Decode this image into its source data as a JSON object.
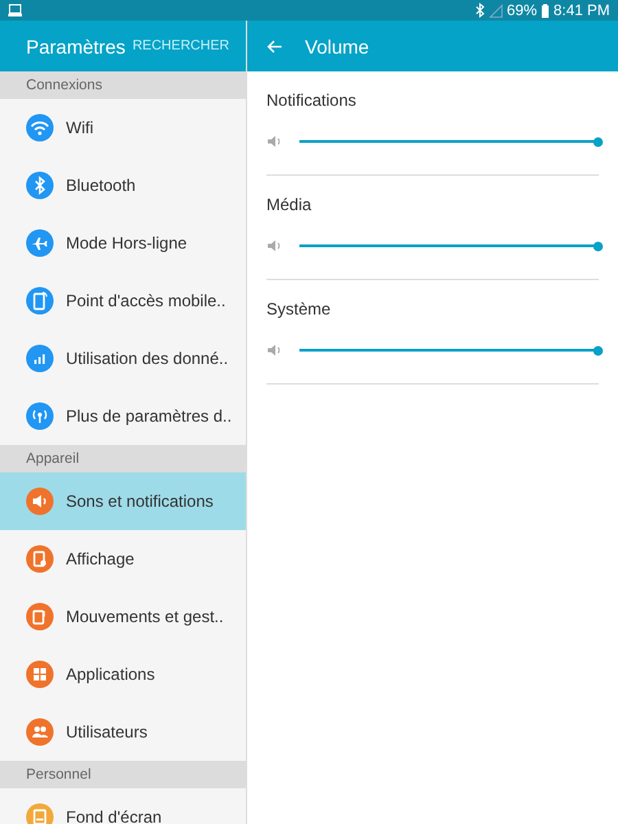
{
  "status_bar": {
    "battery": "69%",
    "time": "8:41 PM"
  },
  "sidebar": {
    "title": "Paramètres",
    "search_button": "RECHERCHER",
    "sections": [
      {
        "header": "Connexions",
        "items": [
          {
            "label": "Wifi",
            "color": "#2196f3",
            "selected": false
          },
          {
            "label": "Bluetooth",
            "color": "#2196f3",
            "selected": false
          },
          {
            "label": "Mode Hors-ligne",
            "color": "#2196f3",
            "selected": false
          },
          {
            "label": "Point d'accès mobile..",
            "color": "#2196f3",
            "selected": false
          },
          {
            "label": "Utilisation des donné..",
            "color": "#2196f3",
            "selected": false
          },
          {
            "label": "Plus de paramètres d..",
            "color": "#2196f3",
            "selected": false
          }
        ]
      },
      {
        "header": "Appareil",
        "items": [
          {
            "label": "Sons et notifications",
            "color": "#f0732b",
            "selected": true
          },
          {
            "label": "Affichage",
            "color": "#f0732b",
            "selected": false
          },
          {
            "label": "Mouvements et gest..",
            "color": "#f0732b",
            "selected": false
          },
          {
            "label": "Applications",
            "color": "#f0732b",
            "selected": false
          },
          {
            "label": "Utilisateurs",
            "color": "#f0732b",
            "selected": false
          }
        ]
      },
      {
        "header": "Personnel",
        "items": [
          {
            "label": "Fond d'écran",
            "color": "#f2a93b",
            "selected": false
          }
        ]
      }
    ]
  },
  "detail": {
    "title": "Volume",
    "channels": [
      {
        "name": "Notifications",
        "level": 1
      },
      {
        "name": "Média",
        "level": 1
      },
      {
        "name": "Système",
        "level": 1
      }
    ]
  }
}
